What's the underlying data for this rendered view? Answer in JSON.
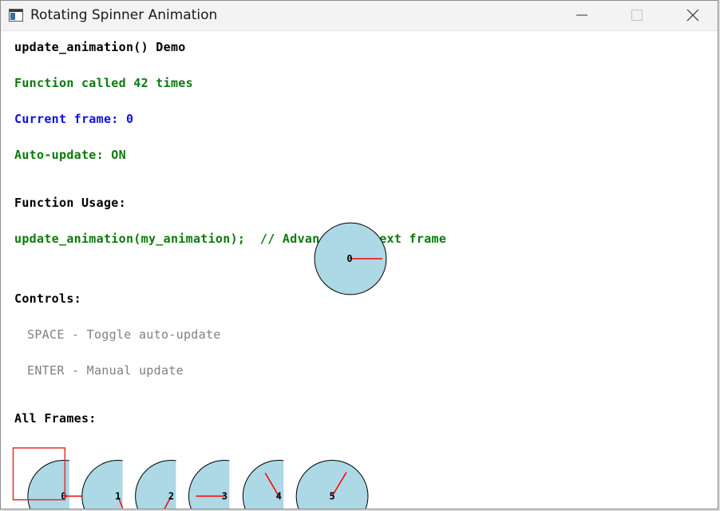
{
  "window": {
    "title": "Rotating Spinner Animation",
    "icon": "app-window-icon"
  },
  "titlebar_buttons": {
    "minimize_icon": "minimize-icon",
    "maximize_icon": "maximize-icon",
    "close_icon": "close-icon"
  },
  "content": {
    "heading": "update_animation() Demo",
    "call_count": "Function called 42 times",
    "current_frame": "Current frame: 0",
    "auto_update": "Auto-update: ON",
    "usage_heading": "Function Usage:",
    "usage_code": "update_animation(my_animation);  // Advances to next frame",
    "controls_heading": "Controls:",
    "control_space": "SPACE - Toggle auto-update",
    "control_enter": "ENTER - Manual update",
    "all_frames_heading": "All Frames:"
  },
  "spinner": {
    "current_frame_label": "0",
    "fill_color": "#add8e6",
    "hand_color": "#ff0000"
  },
  "frames": [
    {
      "label": "0"
    },
    {
      "label": "1"
    },
    {
      "label": "2"
    },
    {
      "label": "3"
    },
    {
      "label": "4"
    },
    {
      "label": "5"
    }
  ],
  "colors": {
    "highlight": "#e03030",
    "text_green": "#0b7a0b",
    "text_blue": "#1010e0"
  }
}
